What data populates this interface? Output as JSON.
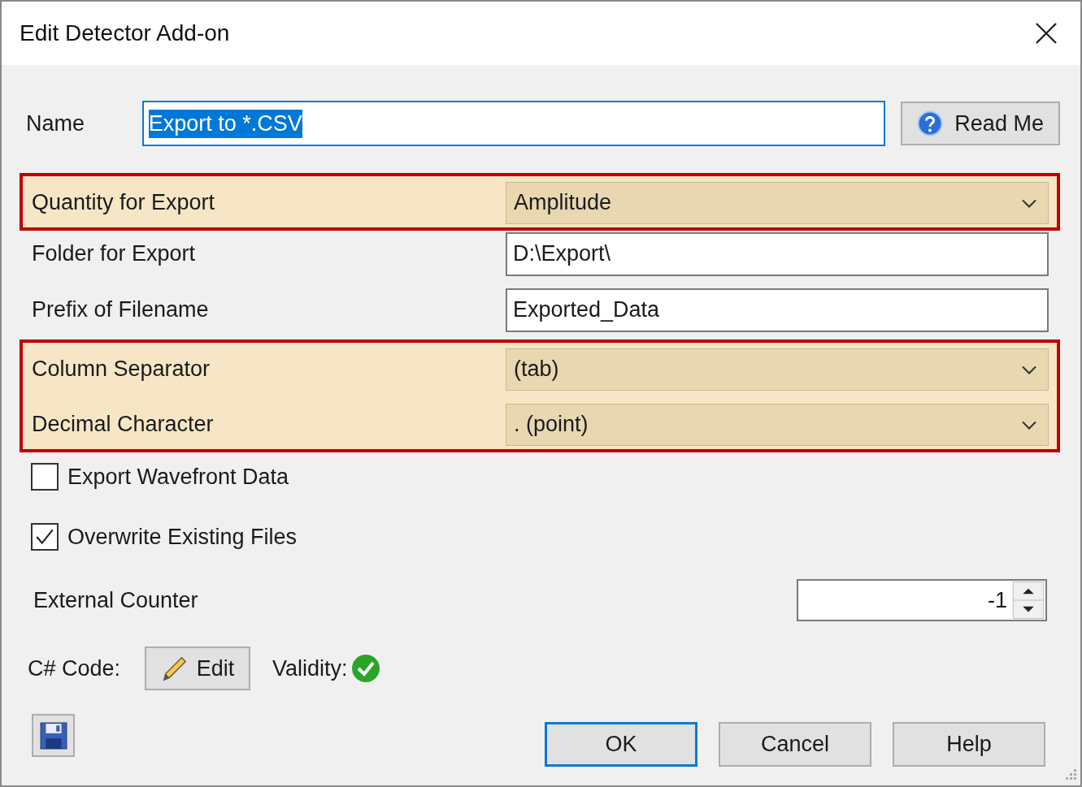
{
  "window": {
    "title": "Edit Detector Add-on"
  },
  "name": {
    "label": "Name",
    "value": "Export to *.CSV",
    "selected": true
  },
  "read_me_button": {
    "label": "Read Me"
  },
  "sections": [
    {
      "highlighted": true,
      "fields": [
        {
          "kind": "dropdown",
          "label": "Quantity for Export",
          "value": "Amplitude"
        }
      ]
    },
    {
      "highlighted": false,
      "fields": [
        {
          "kind": "text",
          "label": "Folder for Export",
          "value": "D:\\Export\\"
        },
        {
          "kind": "text",
          "label": "Prefix of Filename",
          "value": "Exported_Data"
        }
      ]
    },
    {
      "highlighted": true,
      "fields": [
        {
          "kind": "dropdown",
          "label": "Column Separator",
          "value": "(tab)"
        },
        {
          "kind": "dropdown",
          "label": "Decimal Character",
          "value": ". (point)"
        }
      ]
    }
  ],
  "checkboxes": [
    {
      "label": "Export Wavefront Data",
      "checked": false
    },
    {
      "label": "Overwrite Existing Files",
      "checked": true
    }
  ],
  "counter": {
    "label": "External Counter",
    "value": "-1"
  },
  "code": {
    "label": "C# Code:",
    "edit_button": "Edit",
    "validity_label": "Validity:",
    "valid": true
  },
  "buttons": [
    {
      "label": "OK",
      "default": true
    },
    {
      "label": "Cancel",
      "default": false
    },
    {
      "label": "Help",
      "default": false
    }
  ]
}
